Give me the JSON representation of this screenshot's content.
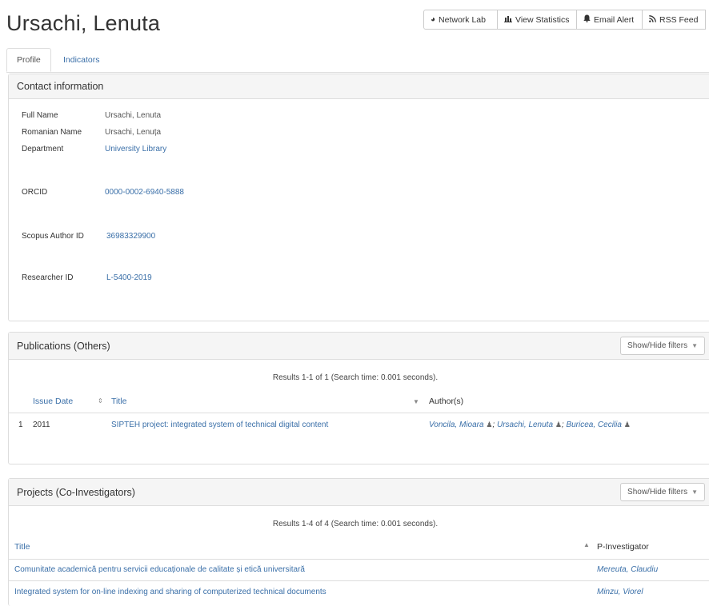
{
  "page": {
    "title": "Ursachi, Lenuta"
  },
  "toolbar": {
    "network_lab": "Network Lab",
    "view_statistics": "View Statistics",
    "email_alert": "Email Alert",
    "rss_feed": "RSS Feed"
  },
  "tabs": [
    {
      "label": "Profile",
      "active": true
    },
    {
      "label": "Indicators",
      "active": false
    }
  ],
  "contact": {
    "heading": "Contact information",
    "fields": [
      {
        "label": "Full Name",
        "value": "Ursachi, Lenuta"
      },
      {
        "label": "Romanian Name",
        "value": "Ursachi, Lenuța"
      },
      {
        "label": "Department",
        "value": "University Library"
      },
      {
        "label": "ORCID",
        "value": "0000-0002-6940-5888"
      },
      {
        "label": "Scopus Author ID",
        "value": "36983329900"
      },
      {
        "label": "Researcher ID",
        "value": "L-5400-2019"
      }
    ]
  },
  "publications": {
    "heading": "Publications (Others)",
    "filters_label": "Show/Hide filters",
    "results_info": "Results 1-1 of 1 (Search time: 0.001 seconds).",
    "columns": {
      "issue_date": "Issue Date",
      "title": "Title",
      "authors": "Author(s)"
    },
    "rows": [
      {
        "index": "1",
        "date": "2011",
        "title": "SIPTEH project: integrated system of technical digital content",
        "authors": [
          "Voncila, Mioara",
          "Ursachi, Lenuta",
          "Buricea, Cecilia"
        ]
      }
    ]
  },
  "projects": {
    "heading": "Projects (Co-Investigators)",
    "filters_label": "Show/Hide filters",
    "results_info": "Results 1-4 of 4 (Search time: 0.001 seconds).",
    "columns": {
      "title": "Title",
      "investigator": "P-Investigator"
    },
    "rows": [
      {
        "title": "Comunitate academică pentru servicii educaționale de calitate și etică universitară",
        "investigator": "Mereuta, Claudiu"
      },
      {
        "title": "Integrated system for on-line indexing and sharing of computerized technical documents",
        "investigator": "Minzu, Viorel"
      }
    ]
  }
}
